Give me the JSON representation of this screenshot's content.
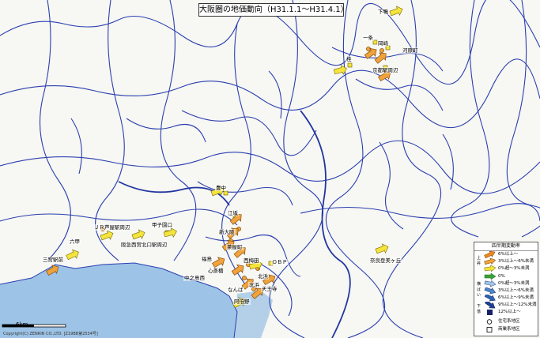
{
  "title": "大阪圏の地価動向（H31.1.1〜H31.4.1）",
  "scale_label": "6km",
  "copyright": "Copyright(C) ZENRIN CO.,LTD. [Z19BB第2534号]",
  "labels": {
    "shimogamo": "下鴨",
    "ichijo": "一条",
    "okazaki": "岡崎",
    "katsura": "桂",
    "kawaramachi": "河原町",
    "kyoto_eki": "京都駅周辺",
    "toyonaka": "豊中",
    "esaka": "江坂",
    "shin_osaka": "新大阪",
    "chayamachi": "茶屋町",
    "nishi_umeda": "西梅田",
    "fukushima": "福島",
    "obp": "ＯＢＰ",
    "kitahama": "北浜",
    "nakanoshima": "中之島西",
    "shinsaibashi": "心斎橋",
    "namba": "なんば",
    "kitaba": "北浜",
    "tennoji": "天王寺",
    "abeno": "阿倍野",
    "kobe_sannomiya": "三宮駅前",
    "rokko": "六甲",
    "r_ashiya": "ＪＲ芦屋駅周辺",
    "hankyu_nishinomiya": "阪急西宮北口駅周辺",
    "koshien": "甲子園口",
    "nara": "奈良登美ヶ丘"
  },
  "legend": {
    "title": "四半期変動率",
    "group_up": "上昇",
    "group_flat": "横ばい",
    "group_down": "下落",
    "rows": [
      {
        "text": "6%以上〜",
        "color": "#e8891f"
      },
      {
        "text": "3%以上〜6%未満",
        "color": "#f0a33a"
      },
      {
        "text": "0%超〜3%未満",
        "color": "#f4e43c"
      },
      {
        "text": "0%",
        "color": "#3aa43a"
      },
      {
        "text": "0%超〜3%未満",
        "color": "#9fc4e6"
      },
      {
        "text": "3%以上〜6%未満",
        "color": "#4f84c6"
      },
      {
        "text": "6%以上〜9%未満",
        "color": "#2f5fb0"
      },
      {
        "text": "9%以上〜12%未満",
        "color": "#1f3f90"
      },
      {
        "text": "12%以上〜",
        "color": "#17206a"
      },
      {
        "text": "住宅系地区",
        "color": "#ffffff"
      },
      {
        "text": "商業系地区",
        "color": "#ffffff"
      }
    ]
  },
  "arrows": [
    {
      "category": "3%以上〜6%未満",
      "label_key": "kyoto_eki"
    },
    {
      "category": "0%超〜3%未満",
      "label_key": "shimogamo"
    },
    {
      "category": "6%以上〜",
      "label_key": "shin_osaka"
    }
  ]
}
